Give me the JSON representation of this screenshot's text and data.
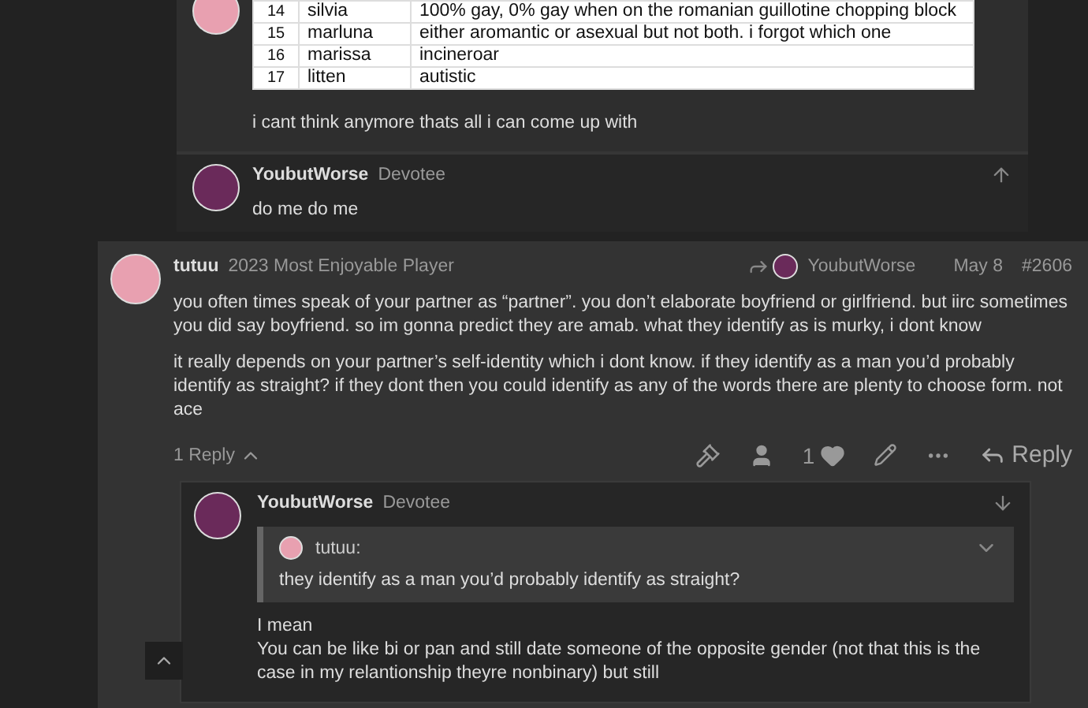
{
  "top_post": {
    "table": {
      "rows": [
        {
          "number": "14",
          "name": "silvia",
          "note": "100% gay, 0% gay when on the romanian guillotine chopping block"
        },
        {
          "number": "15",
          "name": "marluna",
          "note": "either aromantic or asexual but not both. i forgot which one"
        },
        {
          "number": "16",
          "name": "marissa",
          "note": "incineroar"
        },
        {
          "number": "17",
          "name": "litten",
          "note": "autistic"
        }
      ]
    },
    "text": "i cant think anymore thats all i can come up with"
  },
  "reply_post": {
    "username": "YoubutWorse",
    "title": "Devotee",
    "text": "do me do me"
  },
  "main_post": {
    "username": "tutuu",
    "title": "2023 Most Enjoyable Player",
    "reply_to": "YoubutWorse",
    "date": "May 8",
    "post_number": "#2606",
    "paragraphs": [
      "you often times speak of your partner as “partner”. you don’t elaborate boyfriend or girlfriend. but iirc sometimes you did say boyfriend. so im gonna predict they are amab. what they identify as is murky, i dont know",
      "it really depends on your partner’s self-identity which i dont know. if they identify as a man you’d probably identify as straight? if they dont then you could identify as any of the words there are plenty to choose form. not ace"
    ],
    "replies_toggle": {
      "label": "1 Reply",
      "expanded": true
    },
    "like_count": "1",
    "reply_button": "Reply"
  },
  "nested_reply": {
    "username": "YoubutWorse",
    "title": "Devotee",
    "quote": {
      "author": "tutuu:",
      "text": "they identify as a man you’d probably identify as straight?",
      "expanded": false
    },
    "lines": [
      "I mean",
      "You can be like bi or pan and still date someone of the opposite gender (not that this is the case in my relantionship theyre nonbinary) but still"
    ]
  }
}
